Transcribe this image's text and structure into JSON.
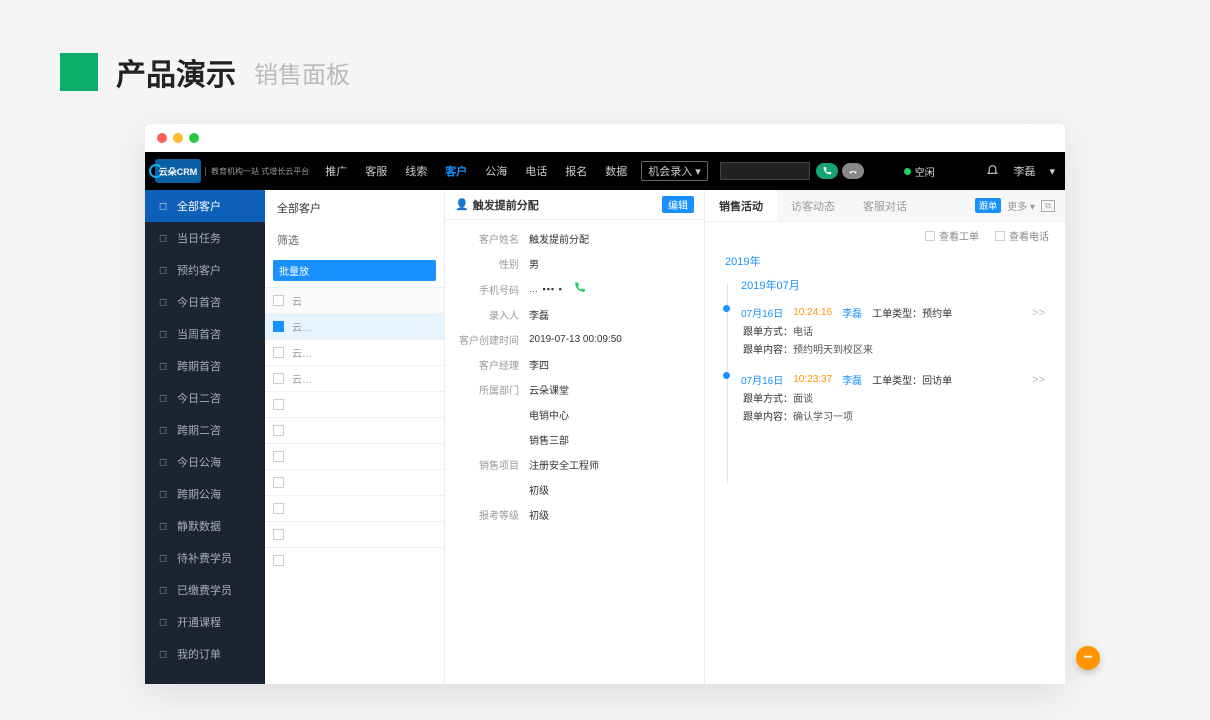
{
  "page_header": {
    "title": "产品演示",
    "subtitle": "销售面板"
  },
  "topnav": {
    "brand": "云朵CRM",
    "brand_sub": "教育机构一站\n式增长云平台",
    "items": [
      "推广",
      "客服",
      "线索",
      "客户",
      "公海",
      "电话",
      "报名",
      "数据"
    ],
    "active_index": 3,
    "opportunity_btn": "机会录入",
    "status_text": "空闲",
    "user_name": "李磊"
  },
  "sidebar": {
    "items": [
      {
        "icon": "user",
        "label": "全部客户",
        "active": true
      },
      {
        "icon": "check",
        "label": "当日任务"
      },
      {
        "icon": "person",
        "label": "预约客户"
      },
      {
        "icon": "consult",
        "label": "今日首咨"
      },
      {
        "icon": "consult",
        "label": "当周首咨"
      },
      {
        "icon": "consult",
        "label": "跨期首咨"
      },
      {
        "icon": "consult",
        "label": "今日二咨"
      },
      {
        "icon": "consult",
        "label": "跨期二咨"
      },
      {
        "icon": "sea",
        "label": "今日公海"
      },
      {
        "icon": "sea",
        "label": "跨期公海"
      },
      {
        "icon": "mute",
        "label": "静默数据"
      },
      {
        "icon": "money",
        "label": "待补费学员"
      },
      {
        "icon": "money",
        "label": "已缴费学员"
      },
      {
        "icon": "course",
        "label": "开通课程"
      },
      {
        "icon": "order",
        "label": "我的订单"
      }
    ]
  },
  "customer_list": {
    "title": "全部客户",
    "filter_label": "筛选",
    "batch_btn": "批量放",
    "header_cell": "云",
    "rows": [
      {
        "sel": true,
        "txt": "云…"
      },
      {
        "sel": false,
        "txt": "云…"
      },
      {
        "sel": false,
        "txt": "云…"
      },
      {
        "sel": false,
        "txt": ""
      },
      {
        "sel": false,
        "txt": ""
      },
      {
        "sel": false,
        "txt": ""
      },
      {
        "sel": false,
        "txt": ""
      },
      {
        "sel": false,
        "txt": ""
      },
      {
        "sel": false,
        "txt": ""
      },
      {
        "sel": false,
        "txt": ""
      }
    ]
  },
  "detail": {
    "title": "触发提前分配",
    "edit_btn": "编辑",
    "fields": [
      {
        "label": "客户姓名",
        "value": "触发提前分配"
      },
      {
        "label": "性别",
        "value": "男"
      },
      {
        "label": "手机号码",
        "value": "… ▪▪▪ ▪",
        "phone": true
      },
      {
        "label": "录入人",
        "value": "李磊"
      },
      {
        "label": "客户创建时间",
        "value": "2019-07-13 00:09:50"
      },
      {
        "label": "客户经理",
        "value": "李四"
      },
      {
        "label": "所属部门",
        "value": "云朵课堂"
      },
      {
        "label": "",
        "value": "电销中心"
      },
      {
        "label": "",
        "value": "销售三部"
      },
      {
        "label": "销售项目",
        "value": "注册安全工程师"
      },
      {
        "label": "",
        "value": "初级"
      },
      {
        "label": "报考等级",
        "value": "初级"
      }
    ]
  },
  "activity": {
    "tabs": [
      "销售活动",
      "访客动态",
      "客服对话"
    ],
    "active_tab": 0,
    "follow_tag": "跟单",
    "more_label": "更多",
    "filters": {
      "view_ticket": "查看工单",
      "view_call": "查看电话"
    },
    "timeline": {
      "year": "2019年",
      "month": "2019年07月",
      "entries": [
        {
          "date": "07月16日",
          "time": "10:24:16",
          "user": "李磊",
          "type_label": "工单类型：",
          "type_value": "预约单",
          "lines": [
            {
              "k": "跟单方式：",
              "v": "电话"
            },
            {
              "k": "跟单内容：",
              "v": "预约明天到校区来"
            }
          ]
        },
        {
          "date": "07月16日",
          "time": "10:23:37",
          "user": "李磊",
          "type_label": "工单类型：",
          "type_value": "回访单",
          "lines": [
            {
              "k": "跟单方式：",
              "v": "面谈"
            },
            {
              "k": "跟单内容：",
              "v": "确认学习一项"
            }
          ]
        }
      ]
    }
  }
}
